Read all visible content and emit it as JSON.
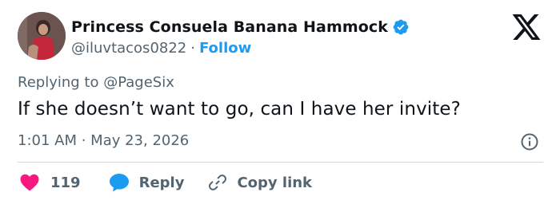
{
  "author": {
    "display_name": "Princess Consuela Banana Hammock",
    "handle": "@iluvtacos0822",
    "separator": "·",
    "follow_label": "Follow"
  },
  "tweet": {
    "replying_to": "Replying to @PageSix",
    "text": "If she doesn’t want to go, can I have her invite?",
    "time": "1:01 AM",
    "time_separator": " · ",
    "date": "May 23, 2026"
  },
  "actions": {
    "like_count": "119",
    "reply_label": "Reply",
    "copy_link_label": "Copy link"
  },
  "colors": {
    "accent": "#1d9bf0",
    "like": "#f91880",
    "text": "#0f1419",
    "muted": "#536471"
  },
  "icons": [
    "verified-badge-icon",
    "x-logo-icon",
    "info-icon",
    "heart-icon",
    "reply-bubble-icon",
    "link-icon"
  ]
}
